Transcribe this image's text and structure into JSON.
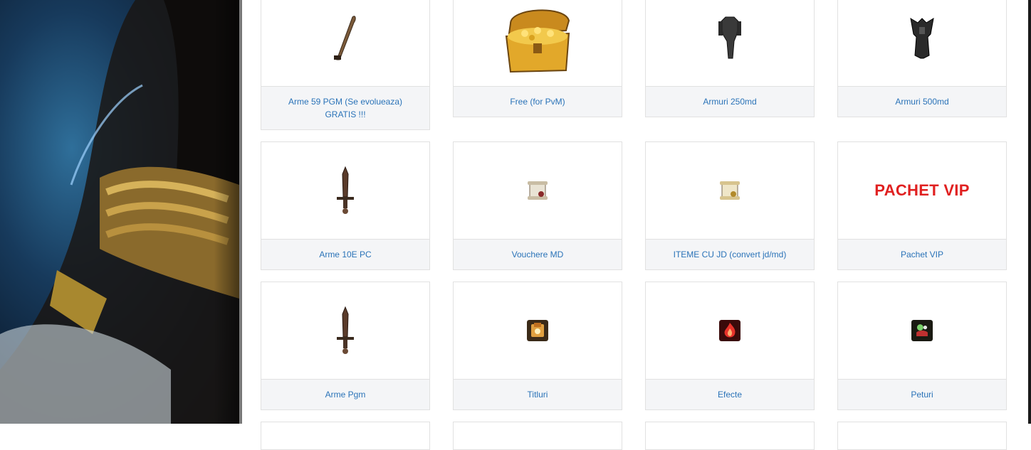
{
  "categories": [
    {
      "label": "Arme 59 PGM (Se evolueaza) GRATIS !!!",
      "icon": "scimitar-icon"
    },
    {
      "label": "Free (for PvM)",
      "icon": "treasure-chest-icon"
    },
    {
      "label": "Armuri 250md",
      "icon": "armor-icon"
    },
    {
      "label": "Armuri 500md",
      "icon": "dark-armor-icon"
    },
    {
      "label": "Arme 10E PC",
      "icon": "sword-icon"
    },
    {
      "label": "Vouchere MD",
      "icon": "scroll-icon"
    },
    {
      "label": "ITEME CU JD (convert jd/md)",
      "icon": "scroll-icon"
    },
    {
      "label": "Pachet VIP",
      "icon": "vip-banner",
      "banner_text": "PACHET VIP"
    },
    {
      "label": "Arme Pgm",
      "icon": "sword-icon"
    },
    {
      "label": "Titluri",
      "icon": "title-icon"
    },
    {
      "label": "Efecte",
      "icon": "flame-effect-icon"
    },
    {
      "label": "Peturi",
      "icon": "pet-icon"
    }
  ],
  "colors": {
    "link": "#2a73b8",
    "vip": "#e02020",
    "label_bg": "#f4f5f7"
  }
}
